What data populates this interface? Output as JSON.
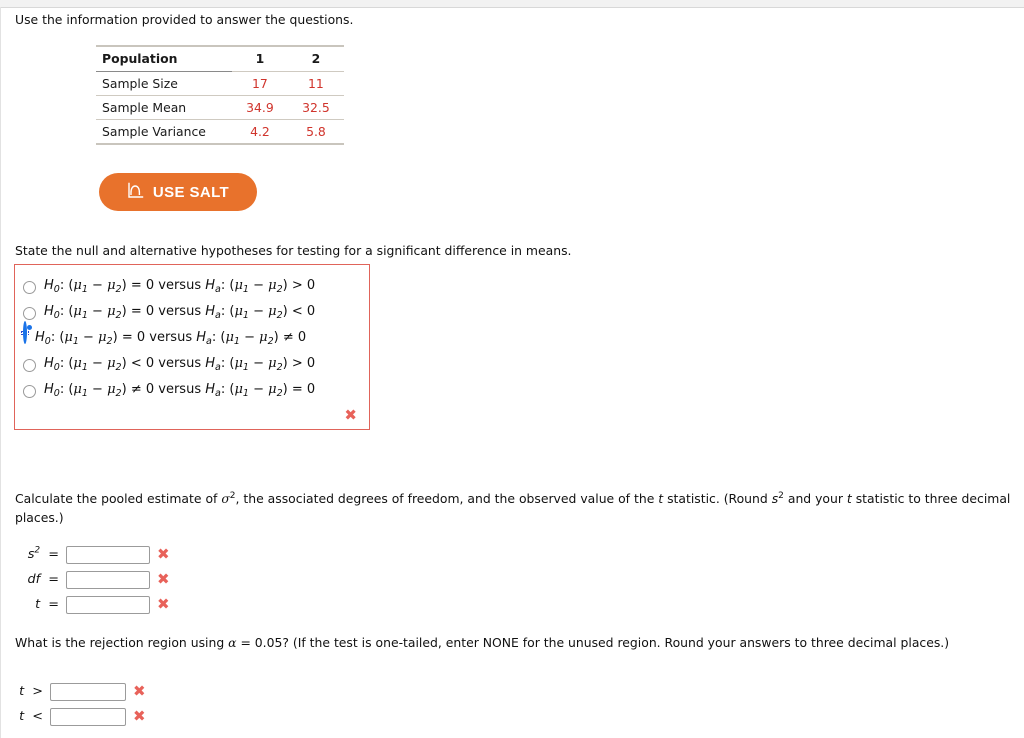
{
  "intro": {
    "text": "Use the information provided to answer the questions."
  },
  "stat_table": {
    "header": [
      "Population",
      "1",
      "2"
    ],
    "rows": [
      {
        "label": "Sample Size",
        "values": [
          "17",
          "11"
        ]
      },
      {
        "label": "Sample Mean",
        "values": [
          "34.9",
          "32.5"
        ]
      },
      {
        "label": "Sample Variance",
        "values": [
          "4.2",
          "5.8"
        ]
      }
    ],
    "value_color": "#d0342c"
  },
  "salt_button": {
    "label": "USE SALT",
    "icon": "distribution-curve-icon",
    "background": "#e8722c"
  },
  "hypotheses_question": {
    "prompt": "State the null and alternative hypotheses for testing for a significant difference in means.",
    "border_color": "#e0645a",
    "selected_index": 2,
    "options": [
      {
        "null_relation": "=",
        "null_value": "0",
        "alt_relation": ">",
        "alt_value": "0",
        "selected": false
      },
      {
        "null_relation": "=",
        "null_value": "0",
        "alt_relation": "<",
        "alt_value": "0",
        "selected": false
      },
      {
        "null_relation": "=",
        "null_value": "0",
        "alt_relation": "≠",
        "alt_value": "0",
        "selected": true
      },
      {
        "null_relation": "<",
        "null_value": "0",
        "alt_relation": ">",
        "alt_value": "0",
        "selected": false
      },
      {
        "null_relation": "≠",
        "null_value": "0",
        "alt_relation": "=",
        "alt_value": "0",
        "selected": false
      }
    ],
    "feedback_mark": "✖"
  },
  "calc_question": {
    "line1_a": "Calculate the pooled estimate of ",
    "sigma": "σ",
    "line1_b": ", the associated degrees of freedom, and the observed value of the ",
    "t1": "t",
    "line1_c": " statistic. (Round ",
    "s1": "s",
    "line1_d": " and your ",
    "t2": "t",
    "line1_e": " statistic to three decimal places.)",
    "fields": [
      {
        "label_base": "s",
        "label_sup": "2",
        "label_op": "=",
        "value": "",
        "placeholder": "",
        "mark": "✖"
      },
      {
        "label_base": "df",
        "label_sup": "",
        "label_op": "=",
        "value": "",
        "placeholder": "",
        "mark": "✖"
      },
      {
        "label_base": "t",
        "label_sup": "",
        "label_op": "=",
        "value": "",
        "placeholder": "",
        "mark": "✖"
      }
    ]
  },
  "rejection_question": {
    "line_a": "What is the rejection region using ",
    "alpha": "α",
    "line_b": " = 0.05? (If the test is one-tailed, enter NONE for the unused region. Round your answers to three decimal places.)",
    "fields": [
      {
        "label_base": "t",
        "label_op": ">",
        "value": "",
        "placeholder": "",
        "mark": "✖"
      },
      {
        "label_base": "t",
        "label_op": "<",
        "value": "",
        "placeholder": "",
        "mark": "✖"
      }
    ]
  }
}
